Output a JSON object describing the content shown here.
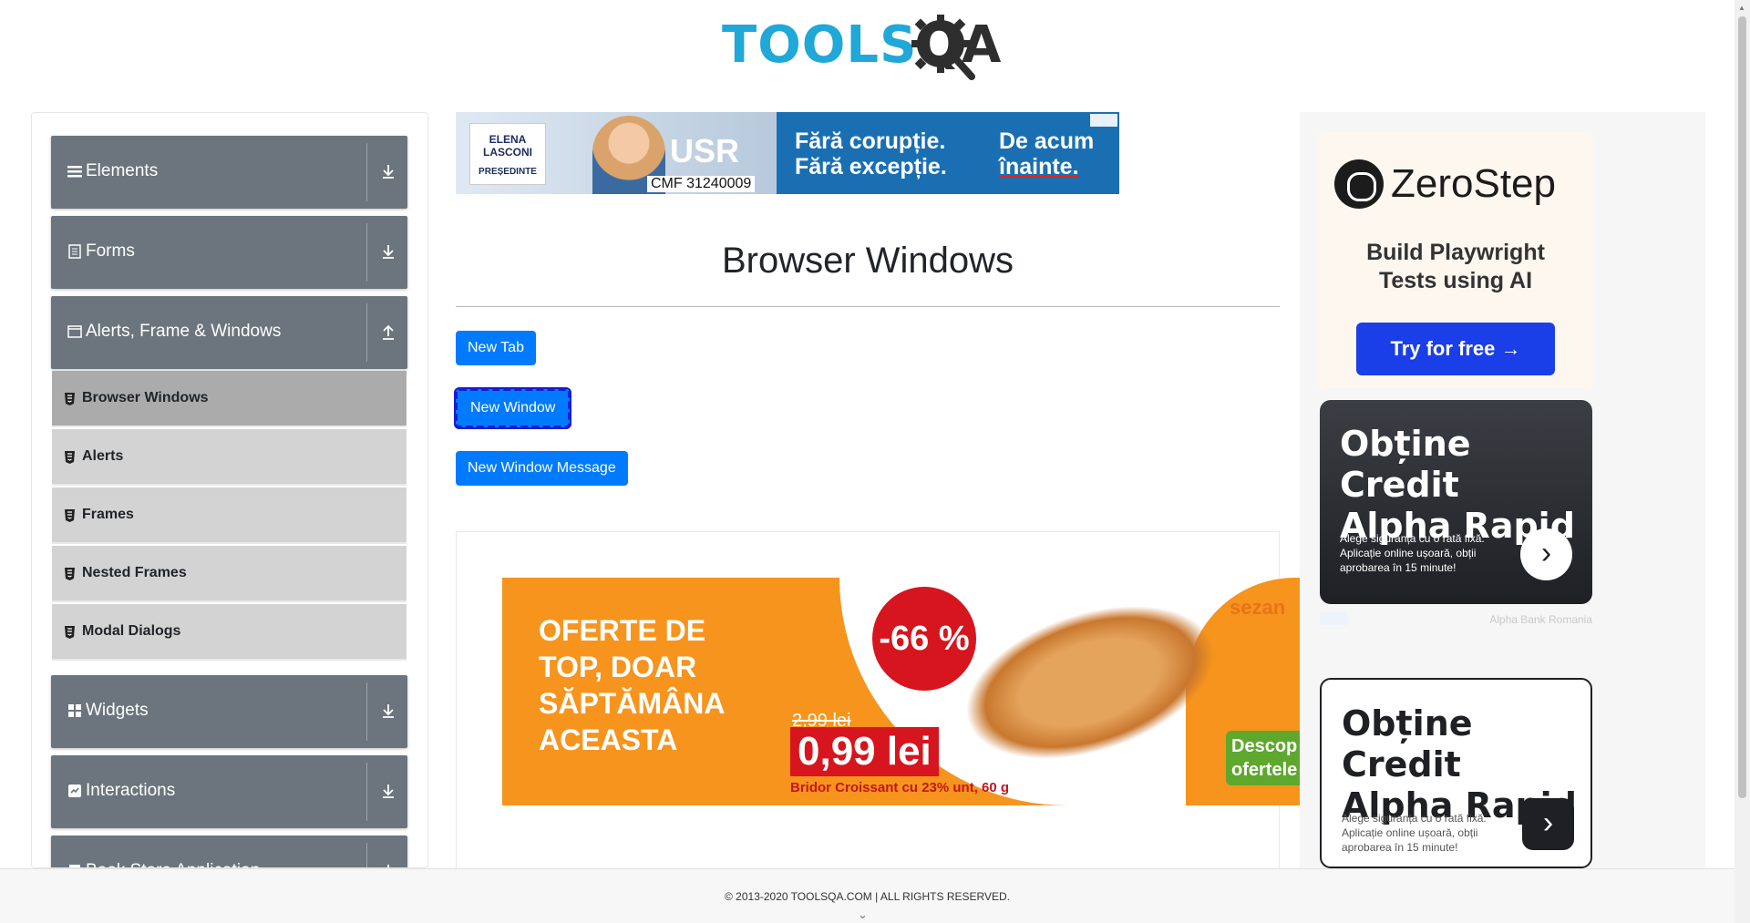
{
  "logo": {
    "part1": "TOOLS",
    "part2": "QA"
  },
  "sidebar": {
    "groups": [
      {
        "label": "Elements",
        "icon": "hamburger-icon",
        "arrow": "download-arrow-icon"
      },
      {
        "label": "Forms",
        "icon": "document-icon",
        "arrow": "download-arrow-icon"
      },
      {
        "label": "Alerts, Frame & Windows",
        "icon": "window-icon",
        "arrow": "upload-arrow-icon"
      },
      {
        "label": "Widgets",
        "icon": "widgets-icon",
        "arrow": "download-arrow-icon"
      },
      {
        "label": "Interactions",
        "icon": "interactions-icon",
        "arrow": "download-arrow-icon"
      },
      {
        "label": "Book Store Application",
        "icon": "book-icon",
        "arrow": "download-arrow-icon"
      }
    ],
    "sub_items": [
      {
        "label": "Browser Windows",
        "active": true
      },
      {
        "label": "Alerts",
        "active": false
      },
      {
        "label": "Frames",
        "active": false
      },
      {
        "label": "Nested Frames",
        "active": false
      },
      {
        "label": "Modal Dialogs",
        "active": false
      }
    ]
  },
  "top_ad": {
    "name_line1": "ELENA",
    "name_line2": "LASCONI",
    "role": "PREȘEDINTE",
    "party": "USR",
    "code": "CMF 31240009",
    "slogan1": "Fără corupție.",
    "slogan2": "Fără excepție.",
    "slogan3": "De acum",
    "slogan4": "înainte."
  },
  "main": {
    "title": "Browser Windows",
    "buttons": {
      "new_tab": "New Tab",
      "new_window": "New Window",
      "new_window_message": "New Window Message"
    }
  },
  "mid_ad": {
    "headline_lines": [
      "OFERTE DE",
      "TOP, DOAR",
      "SĂPTĂMÂNA",
      "ACEASTA"
    ],
    "discount": "-66 %",
    "old_price": "2,99 lei",
    "new_price": "0,99 lei",
    "product": "Bridor Croissant cu 23% unt, 60 g",
    "brand": "sezan",
    "cta": "Descop ofertele"
  },
  "right_ads": {
    "zerostep": {
      "name": "ZeroStep",
      "tagline1": "Build Playwright",
      "tagline2": "Tests using AI",
      "button": "Try for free →"
    },
    "alpha1": {
      "title1": "Obține Credit",
      "title2": "Alpha Rapid",
      "text": "Alege siguranța cu o rată fixă. Aplicație online ușoară, obții aprobarea în 15 minute!",
      "go": "›"
    },
    "owner": "Alpha Bank Romania",
    "alpha2": {
      "title1": "Obține Credit",
      "title2": "Alpha Rapid",
      "text": "Alege siguranța cu o rată fixă. Aplicație online ușoară, obții aprobarea în 15 minute!",
      "go": "›"
    }
  },
  "footer": {
    "text": "© 2013-2020 TOOLSQA.COM | ALL RIGHTS RESERVED."
  },
  "colors": {
    "primary": "#007bff",
    "sidebar_group": "#6c757d",
    "sub_item": "#d3d3d3",
    "sub_item_active": "#ababab"
  }
}
